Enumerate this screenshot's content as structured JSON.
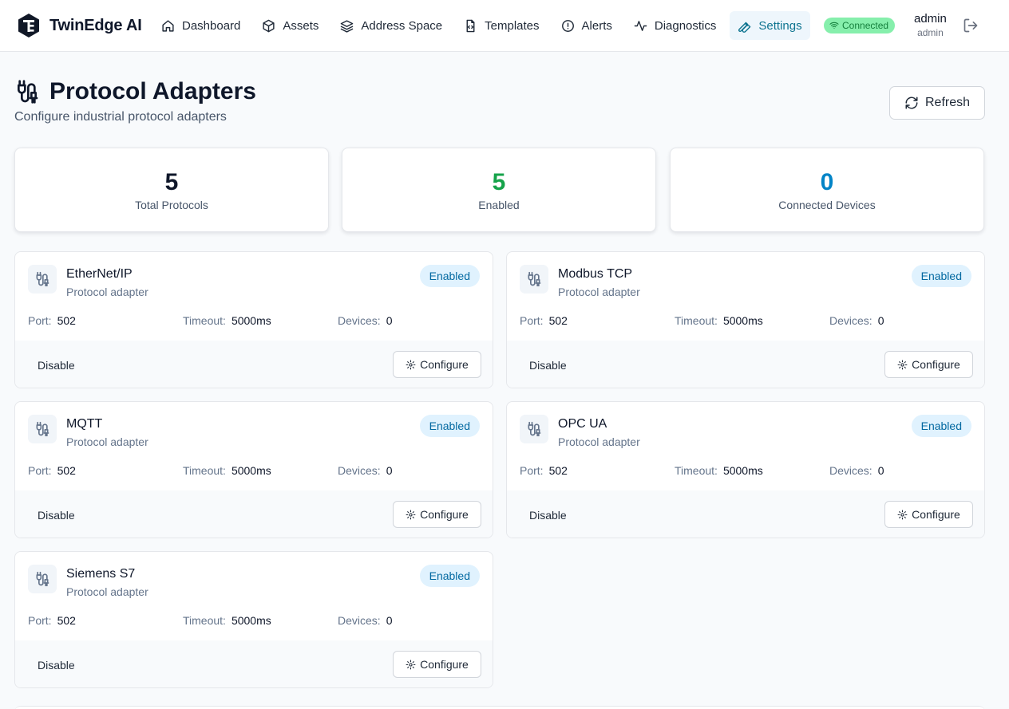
{
  "app": {
    "name": "TwinEdge AI"
  },
  "nav": {
    "items": [
      {
        "label": "Dashboard",
        "icon": "home-icon"
      },
      {
        "label": "Assets",
        "icon": "box-icon"
      },
      {
        "label": "Address Space",
        "icon": "layers-icon"
      },
      {
        "label": "Templates",
        "icon": "file-code-icon"
      },
      {
        "label": "Alerts",
        "icon": "alert-circle-icon"
      },
      {
        "label": "Diagnostics",
        "icon": "activity-icon"
      },
      {
        "label": "Settings",
        "icon": "wrench-icon",
        "active": true
      }
    ]
  },
  "connection": {
    "status": "Connected",
    "color": "#86efac"
  },
  "user": {
    "name": "admin",
    "role": "admin"
  },
  "page": {
    "title": "Protocol Adapters",
    "subtitle": "Configure industrial protocol adapters",
    "refresh_label": "Refresh"
  },
  "stats": [
    {
      "value": "5",
      "label": "Total Protocols",
      "color": "#0f172a"
    },
    {
      "value": "5",
      "label": "Enabled",
      "color": "#16a34a"
    },
    {
      "value": "0",
      "label": "Connected Devices",
      "color": "#0284c7"
    }
  ],
  "labels": {
    "port": "Port:",
    "timeout": "Timeout:",
    "devices": "Devices:",
    "disable": "Disable",
    "configure": "Configure"
  },
  "protocols": [
    {
      "name": "EtherNet/IP",
      "description": "Protocol adapter",
      "status": "Enabled",
      "port": "502",
      "timeout": "5000ms",
      "devices": "0"
    },
    {
      "name": "Modbus TCP",
      "description": "Protocol adapter",
      "status": "Enabled",
      "port": "502",
      "timeout": "5000ms",
      "devices": "0"
    },
    {
      "name": "MQTT",
      "description": "Protocol adapter",
      "status": "Enabled",
      "port": "502",
      "timeout": "5000ms",
      "devices": "0"
    },
    {
      "name": "OPC UA",
      "description": "Protocol adapter",
      "status": "Enabled",
      "port": "502",
      "timeout": "5000ms",
      "devices": "0"
    },
    {
      "name": "Siemens S7",
      "description": "Protocol adapter",
      "status": "Enabled",
      "port": "502",
      "timeout": "5000ms",
      "devices": "0"
    }
  ]
}
